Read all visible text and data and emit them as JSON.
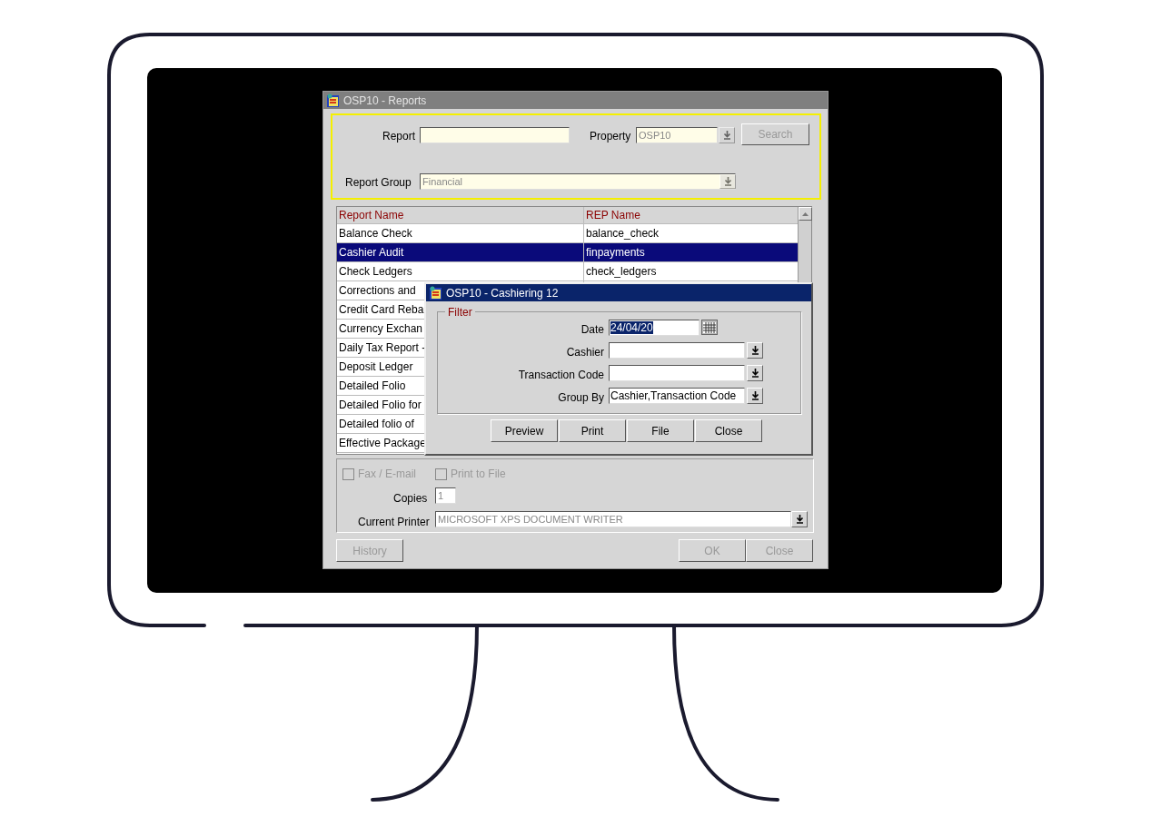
{
  "window": {
    "title": "OSP10 - Reports"
  },
  "search_panel": {
    "report": {
      "label": "Report"
    },
    "property": {
      "label": "Property",
      "value": "OSP10"
    },
    "search_button": {
      "label": "Search",
      "disabled": true
    },
    "report_group": {
      "label": "Report Group",
      "value": "Financial"
    }
  },
  "table": {
    "columns": [
      "Report Name",
      "REP Name"
    ],
    "rows": [
      {
        "cells": [
          "Balance Check",
          "balance_check"
        ],
        "selected": false
      },
      {
        "cells": [
          "Cashier Audit",
          "finpayments"
        ],
        "selected": true
      },
      {
        "cells": [
          "Check Ledgers",
          "check_ledgers"
        ],
        "selected": false
      },
      {
        "cells": [
          "Corrections and"
        ],
        "selected": false
      },
      {
        "cells": [
          "Credit Card Reba"
        ],
        "selected": false
      },
      {
        "cells": [
          "Currency Exchan"
        ],
        "selected": false
      },
      {
        "cells": [
          "Daily Tax Report -"
        ],
        "selected": false
      },
      {
        "cells": [
          "Deposit Ledger"
        ],
        "selected": false
      },
      {
        "cells": [
          "Detailed Folio"
        ],
        "selected": false
      },
      {
        "cells": [
          "Detailed Folio for"
        ],
        "selected": false
      },
      {
        "cells": [
          "Detailed folio of"
        ],
        "selected": false
      },
      {
        "cells": [
          "Effective Package"
        ],
        "selected": false
      }
    ]
  },
  "output": {
    "checkboxes": [
      {
        "label": "Fax / E-mail",
        "checked": false,
        "disabled": true
      },
      {
        "label": "Print to File",
        "checked": false,
        "disabled": true
      }
    ],
    "copies": {
      "label": "Copies",
      "value": "1"
    },
    "printer": {
      "label": "Current Printer",
      "value": "MICROSOFT XPS DOCUMENT WRITER"
    }
  },
  "buttons": [
    {
      "label": "History",
      "disabled": true
    },
    {
      "label": "OK",
      "disabled": true
    },
    {
      "label": "Close",
      "disabled": true
    }
  ],
  "dialog": {
    "title": "OSP10 - Cashiering 12",
    "group": "Filter",
    "fields": [
      {
        "label": "Date",
        "value": "24/04/20",
        "kind": "date"
      },
      {
        "label": "Cashier",
        "kind": "list"
      },
      {
        "label": "Transaction Code",
        "kind": "list"
      },
      {
        "label": "Group By",
        "value": "Cashier,Transaction Code",
        "kind": "list"
      }
    ],
    "buttons": [
      "Preview",
      "Print",
      "File",
      "Close"
    ]
  }
}
